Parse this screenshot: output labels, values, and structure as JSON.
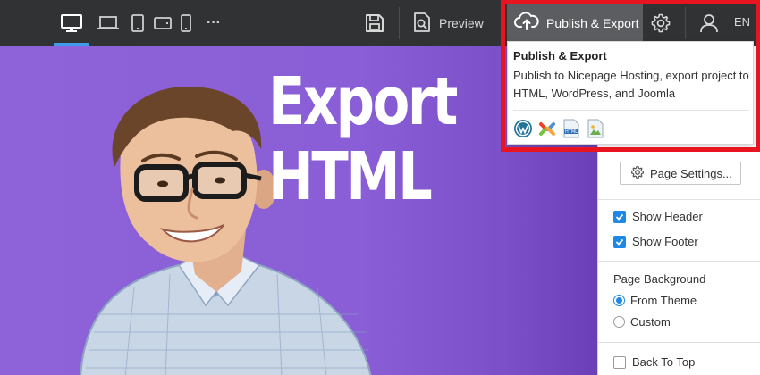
{
  "toolbar": {
    "devices": [
      "desktop-icon",
      "laptop-icon",
      "tablet-icon",
      "tablet-landscape-icon",
      "phone-icon"
    ],
    "more": "···",
    "save_icon": "save-icon",
    "preview_label": "Preview",
    "publish_label": "Publish & Export",
    "settings_icon": "gear-icon",
    "user_icon": "user-icon",
    "language": "EN"
  },
  "tooltip": {
    "title": "Publish & Export",
    "description": "Publish to Nicepage Hosting, export project to HTML, WordPress, and Joomla",
    "icons": [
      "wordpress-icon",
      "joomla-icon",
      "html-icon",
      "image-icon"
    ]
  },
  "canvas": {
    "headline_line1": "Export",
    "headline_line2": "HTML"
  },
  "panel": {
    "page_settings_label": "Page Settings...",
    "show_header": {
      "label": "Show Header",
      "checked": true
    },
    "show_footer": {
      "label": "Show Footer",
      "checked": true
    },
    "page_background_label": "Page Background",
    "from_theme": {
      "label": "From Theme",
      "selected": true
    },
    "custom": {
      "label": "Custom",
      "selected": false
    },
    "back_to_top": {
      "label": "Back To Top",
      "checked": false
    }
  },
  "colors": {
    "toolbar_bg": "#303234",
    "accent_blue": "#1e88e5",
    "canvas_purple": "#8c5fd8",
    "highlight_red": "#e8141f"
  }
}
